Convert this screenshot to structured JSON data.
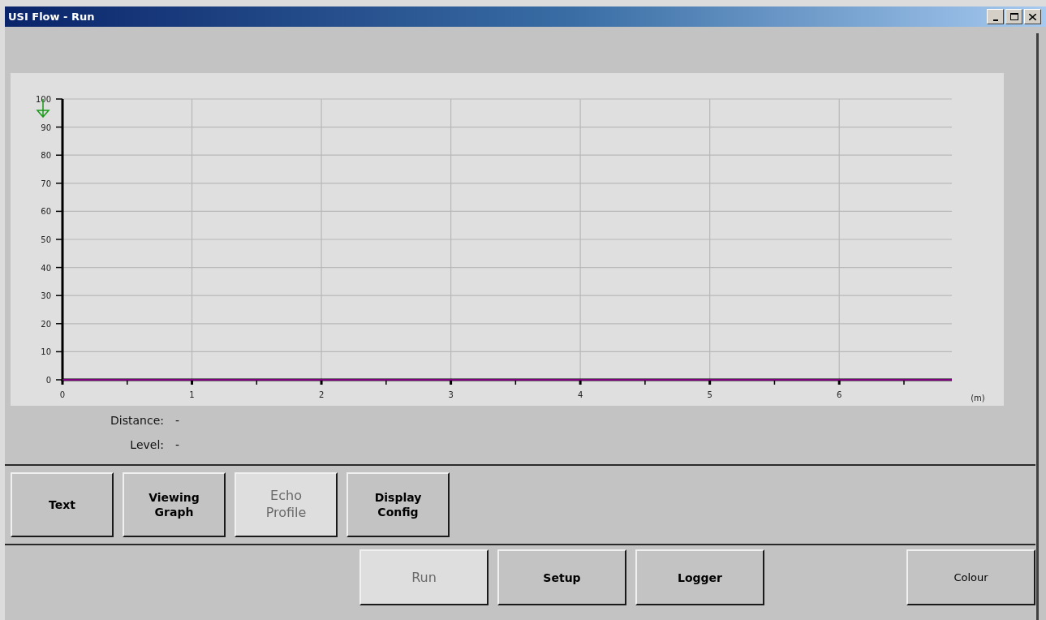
{
  "window": {
    "title": "USI Flow - Run"
  },
  "chart": {
    "chart_data": {
      "type": "line",
      "grid": true,
      "xlabel": "(m)",
      "x": [
        0,
        6.87
      ],
      "xlim": [
        0,
        6.87
      ],
      "ylim": [
        0,
        100
      ],
      "xticks": [
        0,
        1,
        2,
        3,
        4,
        5,
        6
      ],
      "yticks": [
        0,
        10,
        20,
        30,
        40,
        50,
        60,
        70,
        80,
        90,
        100
      ],
      "series": [
        {
          "color": "#800080",
          "values": [
            0,
            0
          ]
        }
      ]
    }
  },
  "readouts": [
    {
      "label": "Distance:",
      "value": "-"
    },
    {
      "label": "Level:",
      "value": "-"
    }
  ],
  "view_buttons": [
    {
      "label": "Text",
      "selected": false
    },
    {
      "label": "Viewing Graph",
      "selected": false
    },
    {
      "label": "Echo Profile",
      "selected": true
    },
    {
      "label": "Display Config",
      "selected": false
    }
  ],
  "action_buttons": [
    {
      "label": "Run",
      "selected": true
    },
    {
      "label": "Setup",
      "selected": false
    },
    {
      "label": "Logger",
      "selected": false
    }
  ],
  "colour_button": {
    "label": "Colour"
  }
}
